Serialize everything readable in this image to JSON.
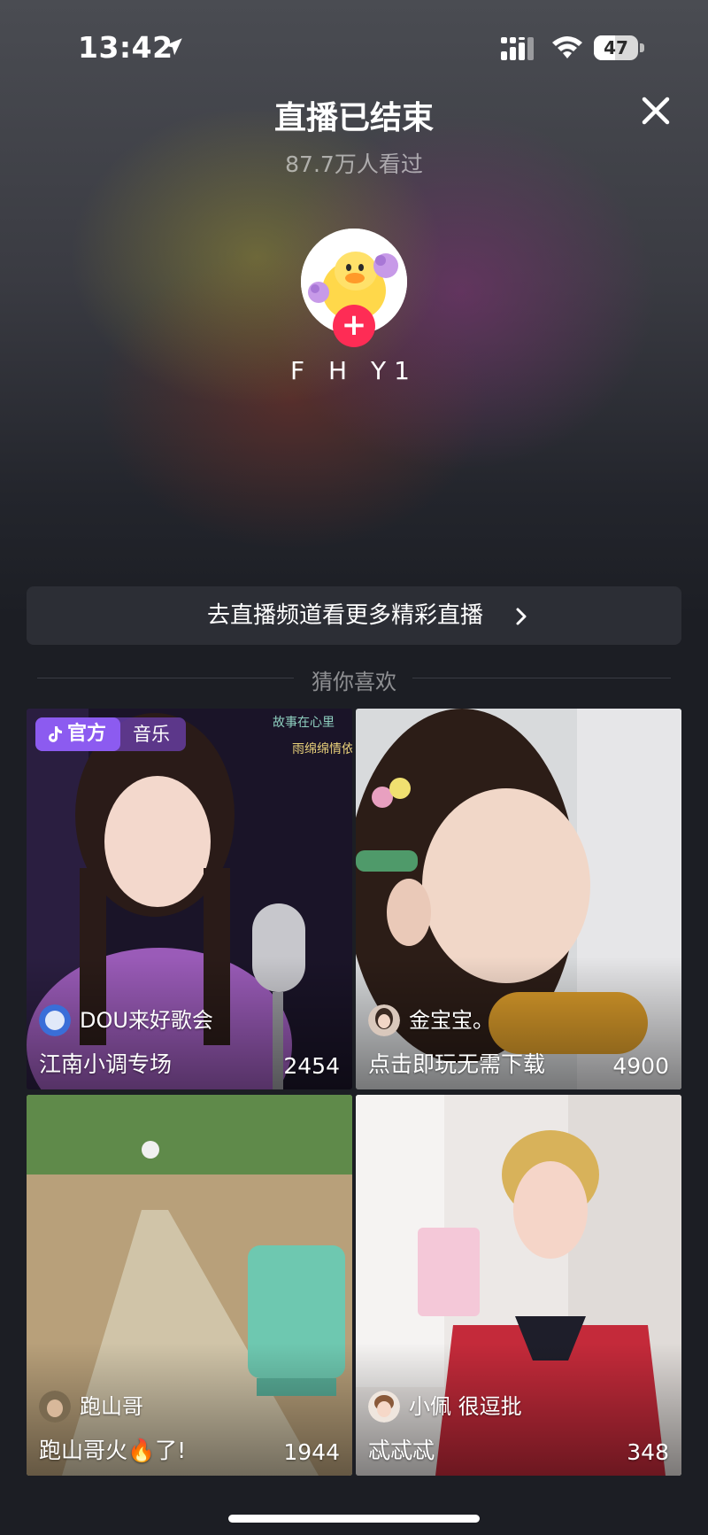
{
  "status_bar": {
    "time": "13:42",
    "battery": "47",
    "icons": [
      "location-arrow-icon",
      "signal-icon",
      "wifi-icon",
      "battery-icon"
    ]
  },
  "header": {
    "title": "直播已结束",
    "viewers": "87.7万人看过",
    "close_icon": "close-icon"
  },
  "host": {
    "name": "F H Y1",
    "follow_icon": "plus-icon"
  },
  "channel_button": {
    "label": "去直播频道看更多精彩直播",
    "icon": "chevron-right-icon"
  },
  "recommend": {
    "title": "猜你喜欢",
    "cards": [
      {
        "badge": "官方",
        "category": "音乐",
        "streamer": "DOU来好歌会",
        "title": "江南小调专场",
        "count": "2454"
      },
      {
        "streamer": "金宝宝。",
        "title": "点击即玩无需下载",
        "count": "4900"
      },
      {
        "streamer": "跑山哥",
        "title": "跑山哥火🔥了!",
        "count": "1944"
      },
      {
        "streamer": "小佩  很逗批",
        "title": "忒忒忒",
        "count": "348"
      }
    ]
  },
  "colors": {
    "accent": "#fe2c55",
    "official_badge": "#8c5bf0",
    "background": "#1c1e24"
  }
}
